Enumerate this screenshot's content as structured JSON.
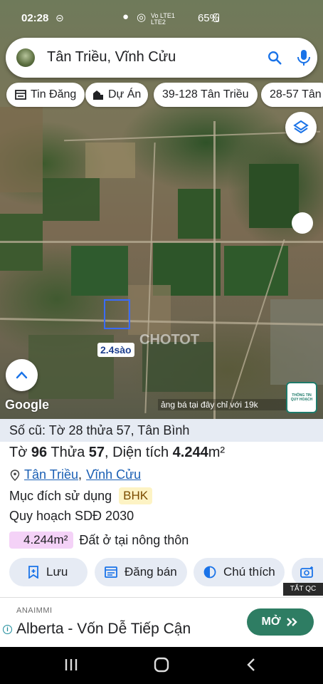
{
  "status_bar": {
    "time": "02:28",
    "signal": "Vo LTE1 LTE2",
    "battery": "65%"
  },
  "search": {
    "query": "Tân Triều, Vĩnh Cửu"
  },
  "chips": [
    {
      "label": "Tin Đăng",
      "icon": "listing-icon"
    },
    {
      "label": "Dự Án",
      "icon": "building-icon"
    },
    {
      "label": "39-128 Tân Triều"
    },
    {
      "label": "28-57 Tân"
    }
  ],
  "map": {
    "area_label": "2.4sào",
    "watermark": "CHOTOT",
    "google": "Google",
    "ad_strip": "ảng bá tại đây chỉ với 19k",
    "badge": [
      "THÔNG TIN",
      "QUY HOẠCH"
    ]
  },
  "panel": {
    "old_info": "Số cũ: Tờ 28 thửa 57, Tân Bình",
    "sheet_label": "Tờ",
    "sheet_no": "96",
    "parcel_label": "Thửa",
    "parcel_no": "57",
    "area_label": ", Diện tích",
    "area_value": "4.244",
    "area_unit": "m²",
    "ward": "Tân Triều",
    "district": "Vĩnh Cửu",
    "separator": ",",
    "purpose_label": "Mục đích sử dụng",
    "purpose_code": "BHK",
    "plan": "Quy hoạch SDĐ 2030",
    "land_area": "4.244m²",
    "land_desc": "Đất ở tại nông thôn",
    "actions": {
      "save": "Lưu",
      "post": "Đăng bán",
      "note": "Chú thích"
    },
    "close_ads": "TẮT QC"
  },
  "ad": {
    "brand": "ANAIMMI",
    "title": "Alberta - Vốn Dễ Tiếp Cận",
    "cta": "MỞ"
  },
  "colors": {
    "accent": "#1a5fb4",
    "parcel": "#3a6bff",
    "cta": "#2e7d63"
  }
}
